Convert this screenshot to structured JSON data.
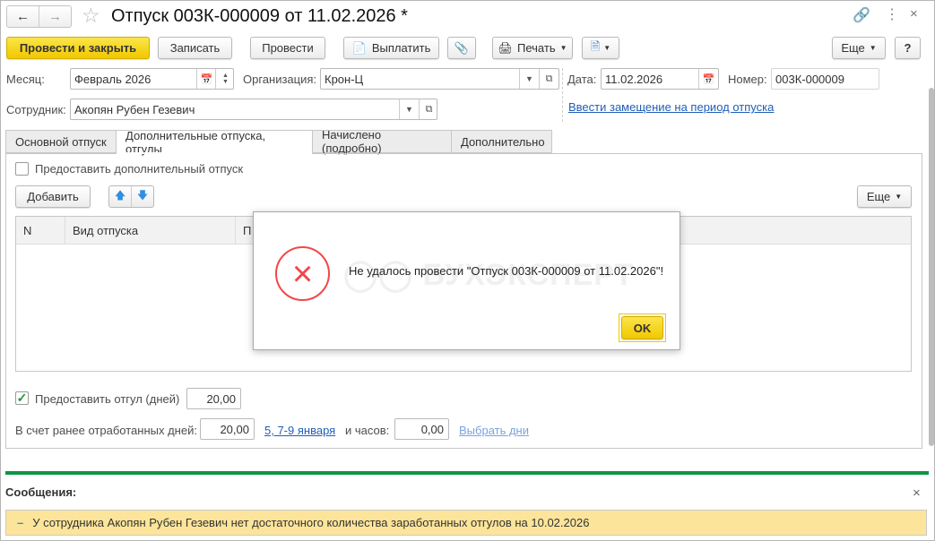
{
  "window": {
    "title": "Отпуск 003К-000009 от 11.02.2026 *"
  },
  "toolbar": {
    "post_close": "Провести и закрыть",
    "save": "Записать",
    "post": "Провести",
    "pay": "Выплатить",
    "print": "Печать",
    "more": "Еще",
    "help": "?"
  },
  "header": {
    "month_label": "Месяц:",
    "month_value": "Февраль 2026",
    "org_label": "Организация:",
    "org_value": "Крон-Ц",
    "date_label": "Дата:",
    "date_value": "11.02.2026",
    "number_label": "Номер:",
    "number_value": "003К-000009",
    "employee_label": "Сотрудник:",
    "employee_value": "Акопян Рубен Гезевич",
    "replace_link": "Ввести замещение на период отпуска"
  },
  "tabs": [
    "Основной отпуск",
    "Дополнительные отпуска, отгулы",
    "Начислено (подробно)",
    "Дополнительно"
  ],
  "panel": {
    "extra_leave_label": "Предоставить дополнительный отпуск",
    "extra_leave_checked": false,
    "add": "Добавить",
    "more": "Еще",
    "columns": [
      "N",
      "Вид отпуска",
      "П"
    ],
    "dayoff_label": "Предоставить отгул (дней)",
    "dayoff_checked": true,
    "dayoff_value": "20,00",
    "worked_label": "В счет ранее отработанных дней:",
    "worked_value": "20,00",
    "worked_dates": "5, 7-9 января",
    "hours_label": "и часов:",
    "hours_value": "0,00",
    "choose_days": "Выбрать дни"
  },
  "dialog": {
    "message": "Не удалось провести \"Отпуск 003К-000009 от 11.02.2026\"!",
    "ok": "OK",
    "watermark": "БУХЭКСПЕРТ"
  },
  "messages": {
    "title": "Сообщения:",
    "items": [
      "У сотрудника Акопян Рубен Гезевич нет достаточного количества заработанных отгулов на 10.02.2026"
    ]
  },
  "colors": {
    "accent": "#f5d20f",
    "error": "#f0484a",
    "messages_bar": "#0e9445",
    "message_bg": "#fce59a",
    "link": "#1f5fb7"
  }
}
